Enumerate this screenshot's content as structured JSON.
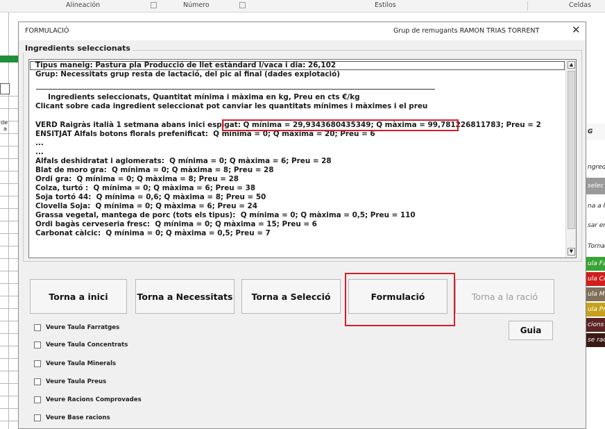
{
  "excel": {
    "ribbon_groups": [
      "Alineación",
      "Número",
      "Estilos",
      "Celdas"
    ],
    "right_cells": [
      {
        "text": "G",
        "color": "#222222",
        "bg": "#f7f7f7"
      },
      {
        "text": "ngred",
        "color": "#222222",
        "bg": "#ffffff"
      },
      {
        "text": "selec",
        "color": "#ffffff",
        "bg": "#9a9a9a"
      },
      {
        "text": "na a N",
        "color": "#222222",
        "bg": "#ffffff"
      },
      {
        "text": "sar en",
        "color": "#222222",
        "bg": "#ffffff"
      },
      {
        "text": "Torna",
        "color": "#222222",
        "bg": "#ffffff"
      },
      {
        "text": "ula Fa",
        "color": "#ffffff",
        "bg": "#3aa335"
      },
      {
        "text": "ula Co",
        "color": "#ffffff",
        "bg": "#cf1f1f"
      },
      {
        "text": "ula M",
        "color": "#ffffff",
        "bg": "#806f5a"
      },
      {
        "text": "ula Pr",
        "color": "#ffffff",
        "bg": "#c6a11d"
      },
      {
        "text": "cions",
        "color": "#ffffff",
        "bg": "#5b2323"
      },
      {
        "text": "se rac",
        "color": "#ffffff",
        "bg": "#3a1a14"
      }
    ],
    "left_fragments": [
      "de",
      "a"
    ]
  },
  "dialog": {
    "title": "FORMULACIÓ",
    "subtitle": "Grup de remugants RAMON TRIAS TORRENT",
    "close_symbol": "✕",
    "group_label": "Ingredients seleccionats",
    "list_lines": [
      "Tipus maneig: Pastura pla Producció de llet estàndard l/vaca i dia: 26,102",
      "Grup: Necessitats grup resta de lactació, del pic al final (dades explotació)",
      "",
      "     Ingredients seleccionats, Quantitat mínima i màxima en kg, Preu en cts €/kg",
      "Clicant sobre cada ingredient seleccionat pot canviar les quantitats mínimes i màximes i el preu",
      "",
      "VERD Raigràs italià 1 setmana abans inici espigat: Q mínima = 29,9343680435349; Q màxima = 99,781226811783; Preu = 2",
      "ENSITJAT Alfals botons florals prefenificat:  Q mínima = 0; Q màxima = 20; Preu = 6",
      "...",
      "...",
      "Alfals deshidratat i aglomerats:  Q mínima = 0; Q màxima = 6; Preu = 28",
      "Blat de moro gra:  Q mínima = 0; Q màxima = 8; Preu = 28",
      "Ordi gra:  Q mínima = 0; Q màxima = 8; Preu = 28",
      "Colza, turtó :  Q mínima = 0; Q màxima = 6; Preu = 38",
      "Soja tortó 44:  Q mínima = 0,6; Q màxima = 8; Preu = 50",
      "Clovella Soja:  Q mínima = 0; Q màxima = 6; Preu = 24",
      "Grassa vegetal, mantega de porc (tots els tipus):  Q mínima = 0; Q màxima = 0,5; Preu = 110",
      "Ordi bagàs cerveseria fresc:  Q mínima = 0; Q màxima = 15; Preu = 6",
      "Carbonat càlcic:  Q mínima = 0; Q màxima = 0,5; Preu = 7"
    ],
    "buttons": {
      "torna_inici": "Torna a inici",
      "torna_necessitats": "Torna a Necessitats",
      "torna_seleccio": "Torna a Selecció",
      "formulacio": "Formulació",
      "torna_racio": "Torna a la ració",
      "guia": "Guia"
    },
    "checkboxes": [
      "Veure Taula Farratges",
      "Veure Taula Concentrats",
      "Veure Taula Minerals",
      "Veure Taula Preus",
      "Veure Racions Comprovades",
      "Veure Base racions"
    ],
    "highlight_color": "#d21f2b"
  }
}
